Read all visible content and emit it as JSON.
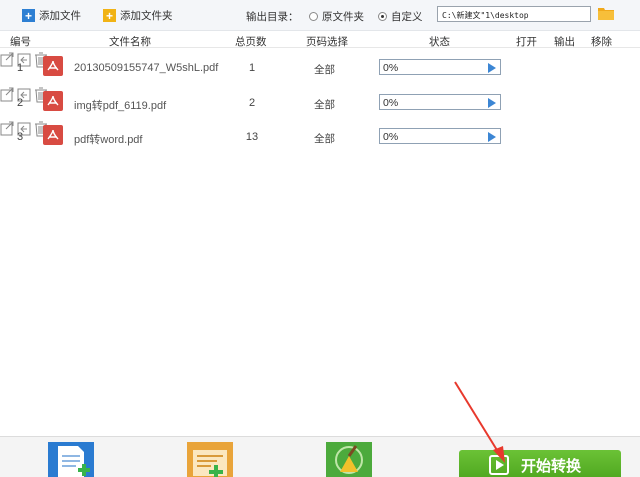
{
  "toolbar": {
    "add_file_label": "添加文件",
    "add_folder_label": "添加文件夹",
    "output_dir_label": "输出目录：",
    "radio_original": "原文件夹",
    "radio_custom": "自定义",
    "selected_radio": "custom",
    "output_path": "C:\\新建文\"1\\desktop"
  },
  "table": {
    "headers": {
      "index": "编号",
      "filename": "文件名称",
      "pages": "总页数",
      "page_range": "页码选择",
      "status": "状态",
      "open": "打开",
      "output": "输出",
      "remove": "移除"
    },
    "rows": [
      {
        "index": "1",
        "filename": "20130509155747_W5shL.pdf",
        "pages": "1",
        "page_range": "全部",
        "progress": "0%"
      },
      {
        "index": "2",
        "filename": "img转pdf_6119.pdf",
        "pages": "2",
        "page_range": "全部",
        "progress": "0%"
      },
      {
        "index": "3",
        "filename": "pdf转word.pdf",
        "pages": "13",
        "page_range": "全部",
        "progress": "0%"
      }
    ]
  },
  "start_button": {
    "label": "开始转换"
  },
  "colors": {
    "accent_blue": "#2d7fd3",
    "start_green": "#5ab52a",
    "pdf_red": "#d84b42",
    "arrow_red": "#e8392d"
  }
}
